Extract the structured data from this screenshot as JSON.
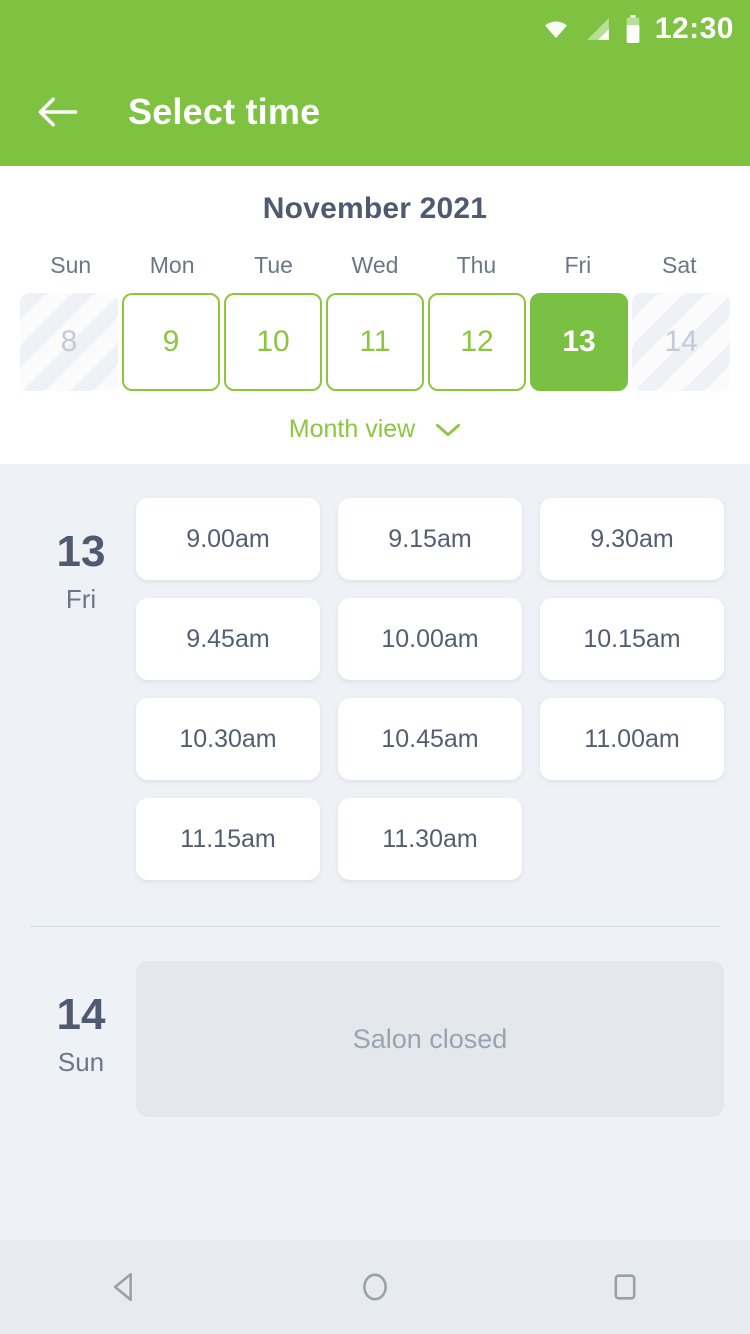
{
  "status_bar": {
    "time": "12:30",
    "icons": [
      "wifi-icon",
      "cellular-signal-icon",
      "battery-icon"
    ]
  },
  "app_bar": {
    "back_icon": "arrow-left-icon",
    "title": "Select time"
  },
  "calendar": {
    "month_title": "November 2021",
    "weekday_headers": [
      "Sun",
      "Mon",
      "Tue",
      "Wed",
      "Thu",
      "Fri",
      "Sat"
    ],
    "days": [
      {
        "number": "8",
        "state": "disabled"
      },
      {
        "number": "9",
        "state": "enabled"
      },
      {
        "number": "10",
        "state": "enabled"
      },
      {
        "number": "11",
        "state": "enabled"
      },
      {
        "number": "12",
        "state": "enabled"
      },
      {
        "number": "13",
        "state": "selected"
      },
      {
        "number": "14",
        "state": "disabled"
      }
    ],
    "month_view_label": "Month view",
    "month_view_icon": "chevron-down-icon"
  },
  "schedule": [
    {
      "day_number": "13",
      "day_name": "Fri",
      "slots": [
        "9.00am",
        "9.15am",
        "9.30am",
        "9.45am",
        "10.00am",
        "10.15am",
        "10.30am",
        "10.45am",
        "11.00am",
        "11.15am",
        "11.30am"
      ]
    },
    {
      "day_number": "14",
      "day_name": "Sun",
      "closed_message": "Salon closed"
    }
  ],
  "nav_bar": {
    "back_icon": "triangle-back-icon",
    "home_icon": "circle-home-icon",
    "recents_icon": "square-recents-icon"
  },
  "colors": {
    "brand_green": "#7fc241",
    "selected_green": "#7ac143",
    "accent_green": "#8cc63f",
    "text_dark": "#4f5a70",
    "text_muted": "#6b7689",
    "background": "#eef1f5",
    "closed_box": "#e4e8ed"
  }
}
